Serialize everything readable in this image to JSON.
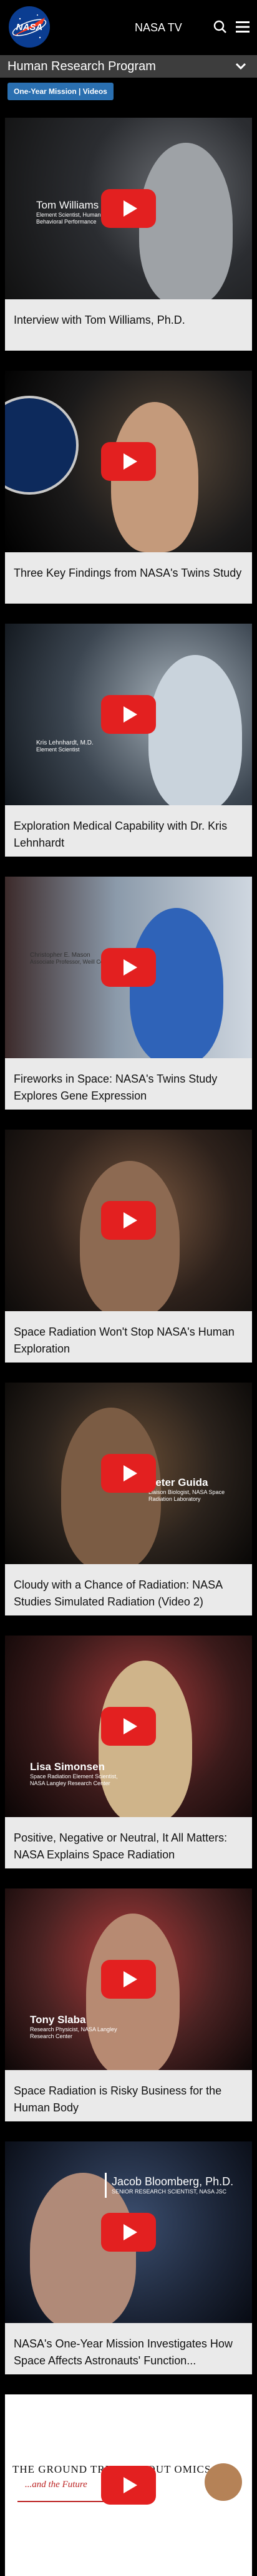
{
  "header": {
    "site_name": "NASA TV"
  },
  "subnav": {
    "title": "Human Research Program"
  },
  "filter": {
    "chip_label": "One-Year Mission | Videos"
  },
  "videos": [
    {
      "title": "Interview with Tom Williams, Ph.D.",
      "lower_name": "Tom Williams",
      "lower_role": "Element Scientist, Human Factors and Behavioral Performance"
    },
    {
      "title": "Three Key Findings from NASA's Twins Study"
    },
    {
      "title": "Exploration Medical Capability with Dr. Kris Lehnhardt",
      "lower_name": "Kris Lehnhardt, M.D.",
      "lower_role": "Element Scientist"
    },
    {
      "title": "Fireworks in Space: NASA's Twins Study Explores Gene Expression",
      "lower_name": "Christopher E. Mason",
      "lower_role": "Associate Professor, Weill Cornell Medicine"
    },
    {
      "title": "Space Radiation Won't Stop NASA's Human Exploration"
    },
    {
      "title": "Cloudy with a Chance of Radiation: NASA Studies Simulated Radiation (Video 2)",
      "lower_name": "Peter Guida",
      "lower_role": "Liaison Biologist, NASA Space Radiation Laboratory"
    },
    {
      "title": "Positive, Negative or Neutral, It All Matters: NASA Explains Space Radiation",
      "lower_name": "Lisa Simonsen",
      "lower_role": "Space Radiation Element Scientist, NASA Langley Research Center"
    },
    {
      "title": "Space Radiation is Risky Business for the Human Body",
      "lower_name": "Tony Slaba",
      "lower_role": "Research Physicist, NASA Langley Research Center"
    },
    {
      "title": "NASA's One-Year Mission Investigates How Space Affects Astronauts' Function...",
      "lower_name": "Jacob Bloomberg, Ph.D.",
      "lower_role": "SENIOR RESEARCH SCIENTIST, NASA JSC"
    },
    {
      "title": "",
      "lower_name": "THE GROUND TRUTH ABOUT OMICS",
      "lower_role": "...and the Future"
    }
  ]
}
